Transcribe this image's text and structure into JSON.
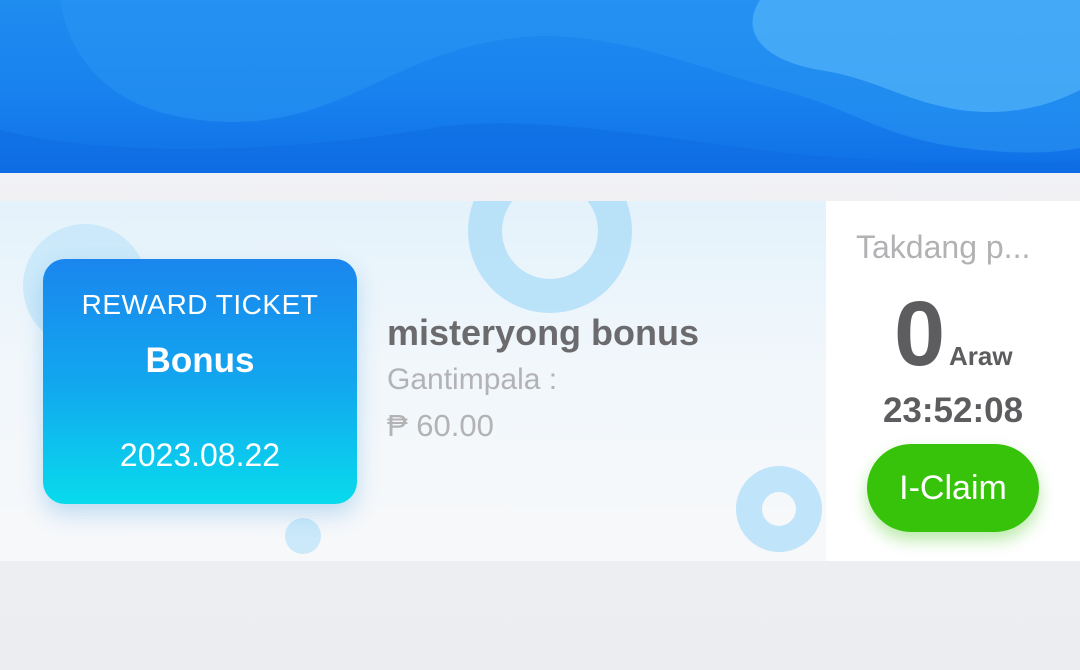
{
  "banner": {
    "background_color": "#1780ee"
  },
  "reward": {
    "ticket": {
      "label": "REWARD TICKET",
      "type": "Bonus",
      "date": "2023.08.22",
      "gradient_top": "#1a86ee",
      "gradient_bottom": "#08dbec"
    },
    "title": "misteryong bonus",
    "reward_label": "Gantimpala :",
    "amount": "₱ 60.00",
    "deadline_label": "Takdang p...",
    "days_remaining": "0",
    "days_unit": "Araw",
    "countdown": "23:52:08",
    "claim_button": {
      "label": "I-Claim",
      "color": "#36c30a"
    }
  }
}
